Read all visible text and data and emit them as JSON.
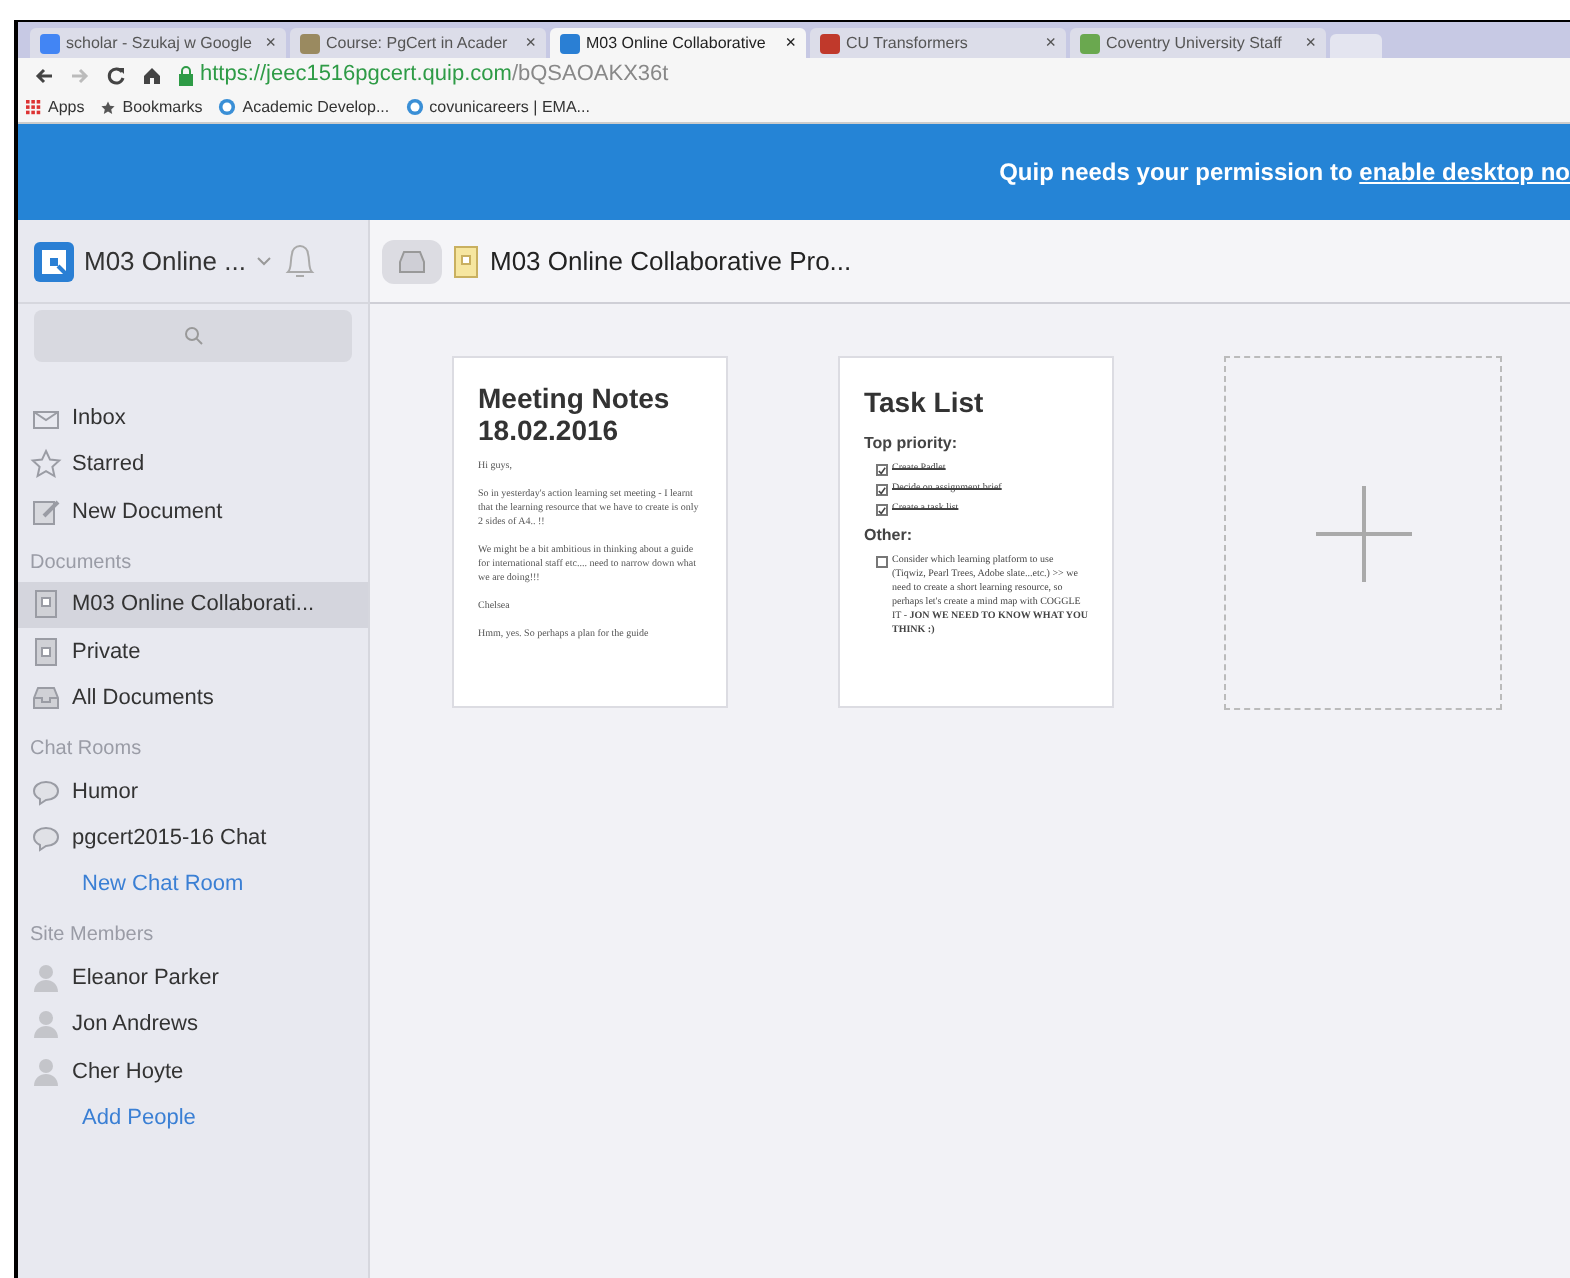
{
  "browser": {
    "tabs": [
      {
        "title": "scholar - Szukaj w Google",
        "kind": "google",
        "selected": false
      },
      {
        "title": "Course: PgCert in Acader",
        "kind": "course",
        "selected": false
      },
      {
        "title": "M03 Online Collaborative",
        "kind": "quip",
        "selected": true
      },
      {
        "title": "CU Transformers",
        "kind": "cu",
        "selected": false
      },
      {
        "title": "Coventry University Staff",
        "kind": "coventry",
        "selected": false
      }
    ],
    "close_glyph": "×",
    "url": {
      "host": "https://jeec1516pgcert.quip.com",
      "path": "/bQSAOAKX36t"
    },
    "bookmarks": [
      {
        "label": "Apps",
        "kind": "apps"
      },
      {
        "label": "Bookmarks",
        "kind": "star"
      },
      {
        "label": "Academic Develop...",
        "kind": "wp"
      },
      {
        "label": "covunicareers | EMA...",
        "kind": "wp"
      }
    ]
  },
  "banner": {
    "text": "Quip needs your permission to",
    "link": "enable desktop no"
  },
  "sidebar": {
    "workspace": "M03 Online ...",
    "nav": [
      {
        "label": "Inbox",
        "kind": "inbox"
      },
      {
        "label": "Starred",
        "kind": "star"
      },
      {
        "label": "New Document",
        "kind": "compose"
      }
    ],
    "sections": [
      {
        "title": "Documents",
        "items": [
          {
            "label": "M03 Online Collaborati...",
            "kind": "folder",
            "selected": true
          },
          {
            "label": "Private",
            "kind": "lock",
            "selected": false
          },
          {
            "label": "All Documents",
            "kind": "tray",
            "selected": false
          }
        ]
      },
      {
        "title": "Chat Rooms",
        "items": [
          {
            "label": "Humor",
            "kind": "chat",
            "selected": false
          },
          {
            "label": "pgcert2015-16 Chat",
            "kind": "chat",
            "selected": false
          }
        ],
        "link": "New Chat Room"
      },
      {
        "title": "Site Members",
        "items": [
          {
            "label": "Eleanor Parker",
            "kind": "person",
            "selected": false
          },
          {
            "label": "Jon Andrews",
            "kind": "person",
            "selected": false
          },
          {
            "label": "Cher Hoyte",
            "kind": "person",
            "selected": false
          }
        ],
        "link": "Add People"
      }
    ]
  },
  "folder": {
    "title": "M03 Online Collaborative Pro...",
    "documents": [
      {
        "kind": "notes",
        "title": "Meeting Notes 18.02.2016",
        "paragraphs": [
          "Hi guys,",
          "So in yesterday's action learning set meeting - I learnt that the learning resource that we have to create is only 2 sides of A4.. !!",
          "We might be a bit ambitious in thinking about a guide for international staff etc.... need to narrow down what we are doing!!!",
          "Chelsea",
          "Hmm, yes. So perhaps a plan for the guide"
        ]
      },
      {
        "kind": "tasks",
        "title": "Task List",
        "groups": [
          {
            "heading": "Top priority:",
            "tasks": [
              {
                "text": "Create Padlet",
                "checked": true
              },
              {
                "text": "Decide on assignment brief",
                "checked": true
              },
              {
                "text": "Create a task list",
                "checked": true
              }
            ]
          },
          {
            "heading": "Other:",
            "tasks": [
              {
                "text": "Consider which learning platform to use (Tiqwiz, Pearl Trees, Adobe slate...etc.) >> we need to create a short learning resource, so perhaps let's create a mind map with COGGLE IT - **JON WE NEED TO KNOW WHAT YOU THINK :)**",
                "checked": false
              }
            ]
          }
        ]
      }
    ]
  }
}
